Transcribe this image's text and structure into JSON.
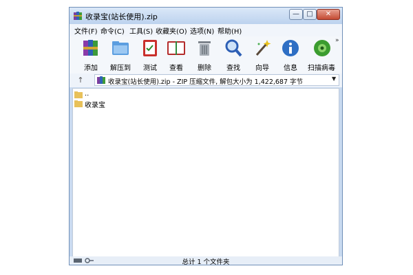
{
  "window": {
    "title": "收录宝(站长使用).zip",
    "controls": {
      "minimize": "—",
      "maximize": "□",
      "close": "✕"
    }
  },
  "menu": [
    "文件(F)",
    "命令(C)",
    "工具(S)",
    "收藏夹(O)",
    "选项(N)",
    "帮助(H)"
  ],
  "toolbar": {
    "items": [
      {
        "label": "添加",
        "icon": "books-add-icon"
      },
      {
        "label": "解压到",
        "icon": "folder-extract-icon"
      },
      {
        "label": "测试",
        "icon": "test-checklist-icon"
      },
      {
        "label": "查看",
        "icon": "open-book-icon"
      },
      {
        "label": "删除",
        "icon": "trash-bin-icon"
      },
      {
        "label": "查找",
        "icon": "magnifier-icon"
      },
      {
        "label": "向导",
        "icon": "magic-wand-icon"
      },
      {
        "label": "信息",
        "icon": "info-icon"
      },
      {
        "label": "扫描病毒",
        "icon": "virus-scan-icon"
      }
    ],
    "more": "»"
  },
  "address": {
    "up": "↑",
    "text": "收录宝(站长使用).zip - ZIP 压缩文件, 解包大小为 1,422,687 字节",
    "dropdown": "▼"
  },
  "files": [
    {
      "name": ".."
    },
    {
      "name": "收录宝"
    }
  ],
  "status": {
    "text": "总计 1 个文件夹"
  },
  "colors": {
    "frame": "#c9daf0",
    "accent": "#3b6fb6",
    "folder": "#e8c15a"
  }
}
